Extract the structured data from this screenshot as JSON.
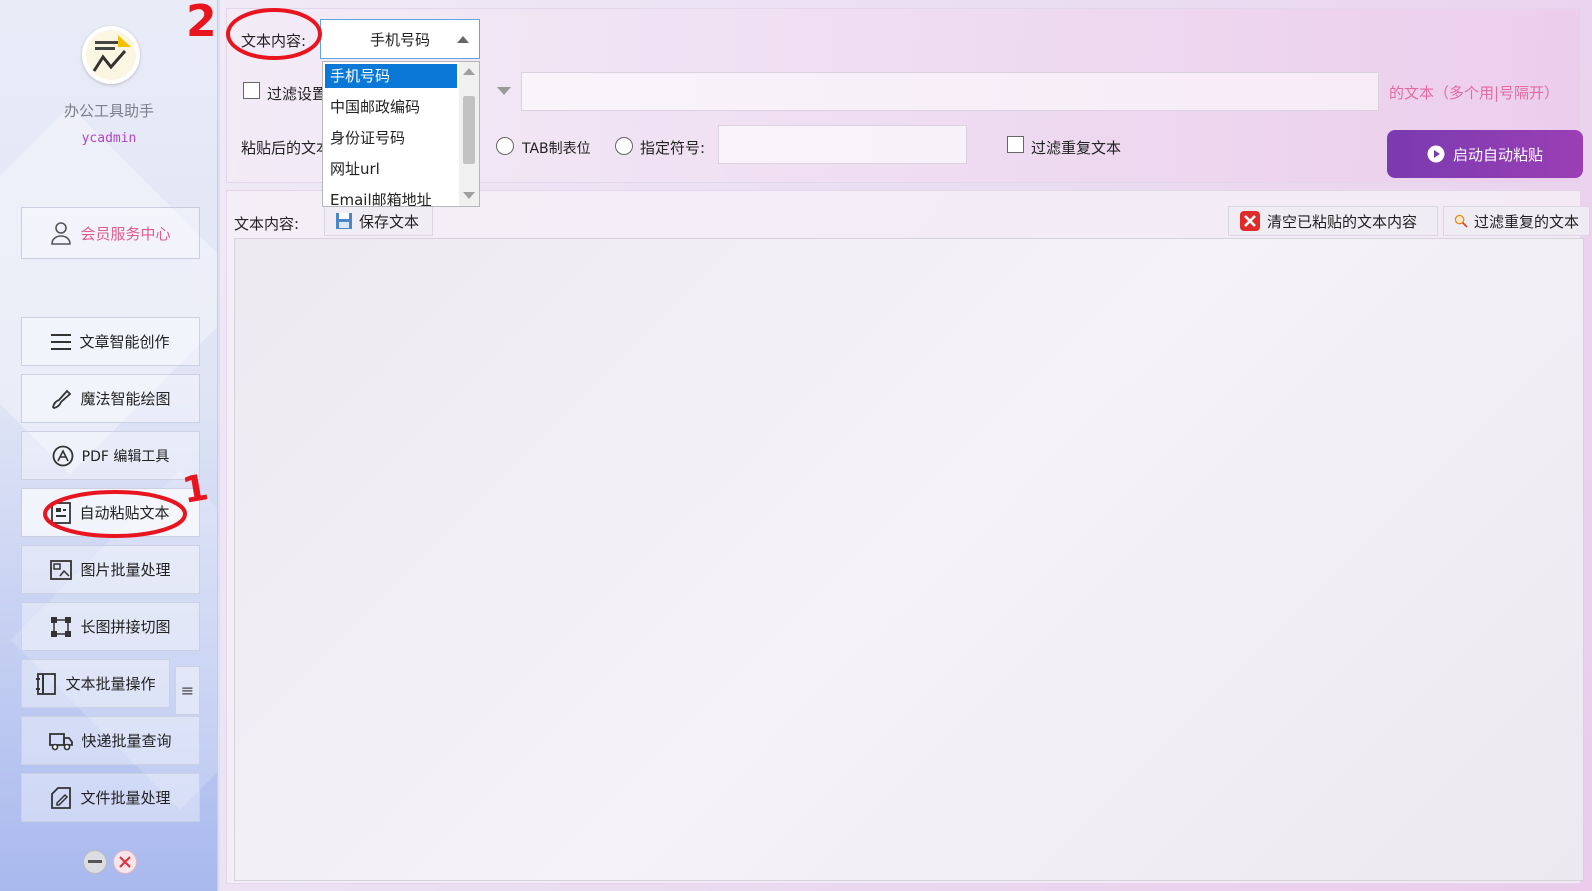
{
  "sidebar": {
    "app_name": "办公工具助手",
    "user_name": "ycadmin",
    "member_center": "会员服务中心",
    "items": [
      {
        "label": "文章智能创作",
        "icon": "list-icon"
      },
      {
        "label": "魔法智能绘图",
        "icon": "brush-icon"
      },
      {
        "label": "PDF 编辑工具",
        "icon": "pdf-tool-icon"
      },
      {
        "label": "自动粘贴文本",
        "icon": "paste-text-icon"
      },
      {
        "label": "图片批量处理",
        "icon": "image-icon"
      },
      {
        "label": "长图拼接切图",
        "icon": "crop-icon"
      },
      {
        "label": "文本批量操作",
        "icon": "book-icon"
      },
      {
        "label": "快递批量查询",
        "icon": "truck-icon"
      },
      {
        "label": "文件批量处理",
        "icon": "file-edit-icon"
      }
    ],
    "menu_glyph": "≡"
  },
  "top": {
    "content_label": "文本内容:",
    "content_value": "手机号码",
    "filter_label": "过滤设置",
    "filter_hint": "的文本（多个用|号隔开）",
    "paste_label": "粘贴后的文本",
    "tab_option": "TAB制表位",
    "symbol_option": "指定符号:",
    "dedupe_checkbox": "过滤重复文本",
    "start_button": "启动自动粘贴"
  },
  "dropdown": {
    "options": [
      "手机号码",
      "中国邮政编码",
      "身份证号码",
      "网址url",
      "Email邮箱地址"
    ],
    "selected_index": 0
  },
  "content": {
    "label": "文本内容:",
    "save_button": "保存文本",
    "clear_button": "清空已粘贴的文本内容",
    "filter_button": "过滤重复的文本"
  },
  "annotations": {
    "mark_2": "2",
    "mark_1": "1"
  },
  "colors": {
    "accent_pink": "#e05c8a",
    "username_purple": "#b145c8",
    "start_button_purple": "#8a3cb2",
    "dropdown_selection": "#0a78d6",
    "annotation_red": "#e8141e"
  }
}
